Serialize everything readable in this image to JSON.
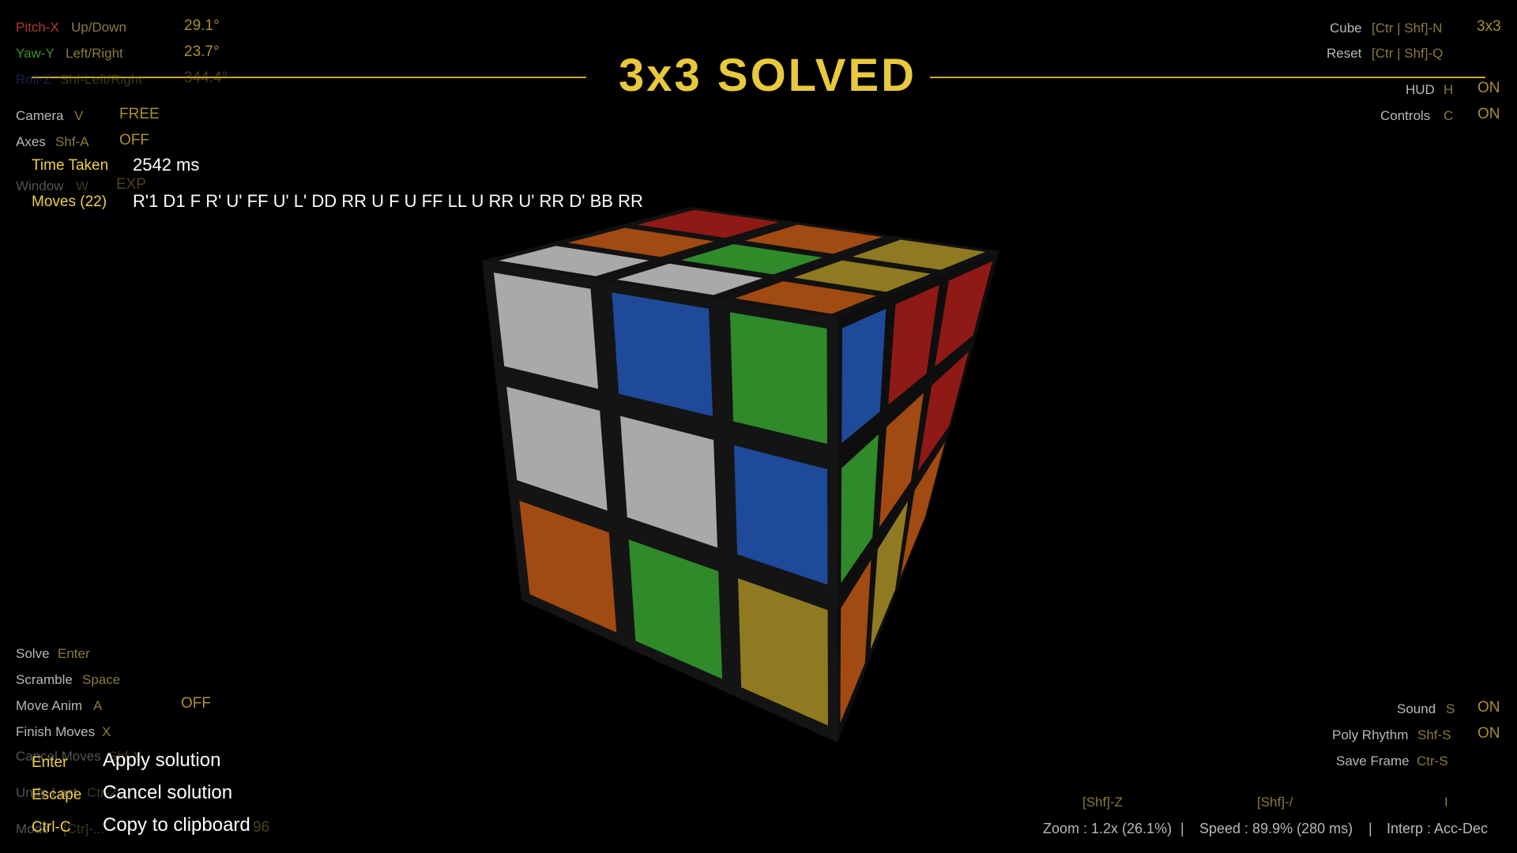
{
  "title": "3x3  SOLVED",
  "top_left": {
    "pitch": {
      "label": "Pitch-X",
      "key": "Up/Down",
      "value": "29.1°"
    },
    "yaw": {
      "label": "Yaw-Y",
      "key": "Left/Right",
      "value": "23.7°"
    },
    "roll": {
      "label": "Roll-Z",
      "key": "Shf-Left/Right",
      "value": "344.4°"
    },
    "camera": {
      "label": "Camera",
      "key": "V",
      "value": "FREE"
    },
    "axes": {
      "label": "Axes",
      "key": "Shf-A",
      "value": "OFF"
    },
    "window": {
      "label": "Window",
      "key": "W",
      "value": "EXP"
    }
  },
  "solution": {
    "time_label": "Time Taken",
    "time_value": "2542  ms",
    "moves_label": "Moves (22)",
    "moves_value": "R'1 D1 F R' U' FF U' L' DD RR U F U FF LL U RR U' RR D' BB RR"
  },
  "top_right": {
    "cube": {
      "label": "Cube",
      "key": "[Ctr | Shf]-N",
      "value": "3x3"
    },
    "reset": {
      "label": "Reset",
      "key": "[Ctr | Shf]-Q"
    },
    "hud": {
      "label": "HUD",
      "key": "H",
      "value": "ON"
    },
    "controls": {
      "label": "Controls",
      "key": "C",
      "value": "ON"
    }
  },
  "bottom_left": {
    "solve": {
      "label": "Solve",
      "key": "Enter"
    },
    "scramble": {
      "label": "Scramble",
      "key": "Space"
    },
    "move_anim": {
      "label": "Move Anim",
      "key": "A",
      "value": "OFF"
    },
    "finish": {
      "label": "Finish Moves",
      "key": "X"
    },
    "cancel": {
      "label": "Cancel Moves",
      "key": "Shf-X"
    },
    "undo": {
      "label": "Undo Last",
      "key": "Ctr-Z"
    },
    "mode": {
      "label": "Mode",
      "key": "[Ctr]-...",
      "value": "96"
    }
  },
  "popup": {
    "apply": {
      "key": "Enter",
      "text": "Apply solution"
    },
    "cancel": {
      "key": "Escape",
      "text": "Cancel solution"
    },
    "copy": {
      "key": "Ctrl-C",
      "text": "Copy to clipboard"
    }
  },
  "bottom_right": {
    "sound": {
      "label": "Sound",
      "key": "S",
      "value": "ON"
    },
    "poly": {
      "label": "Poly Rhythm",
      "key": "Shf-S",
      "value": "ON"
    },
    "save": {
      "label": "Save Frame",
      "key": "Ctr-S"
    }
  },
  "status": {
    "zoom_key": "[Shf]-Z",
    "speed_key": "[Shf]-/",
    "interp_key": "I",
    "zoom": "Zoom : 1.2x (26.1%)",
    "sep1": "|",
    "speed": "Speed : 89.9% (280 ms)",
    "sep2": "|",
    "interp": "Interp : Acc-Dec"
  },
  "colors": {
    "accent": "#f0d040",
    "pitch": "#b03a2e",
    "yaw": "#3f8f2f",
    "roll": "#3446a8",
    "white": "#a9a9a9",
    "blue": "#1f4a9a",
    "green": "#2f8a2a",
    "red": "#8f1a15",
    "orange": "#a14a12",
    "yellow": "#8f7a22"
  },
  "cube_faces": {
    "top": [
      [
        "red",
        "orange",
        "yellow"
      ],
      [
        "orange",
        "green",
        "yellow"
      ],
      [
        "white",
        "white",
        "orange"
      ]
    ],
    "front": [
      [
        "white",
        "blue",
        "green"
      ],
      [
        "white",
        "white",
        "blue"
      ],
      [
        "orange",
        "green",
        "yellow"
      ]
    ],
    "right": [
      [
        "blue",
        "red",
        "red"
      ],
      [
        "green",
        "orange",
        "red"
      ],
      [
        "orange",
        "yellow",
        "orange"
      ]
    ]
  }
}
